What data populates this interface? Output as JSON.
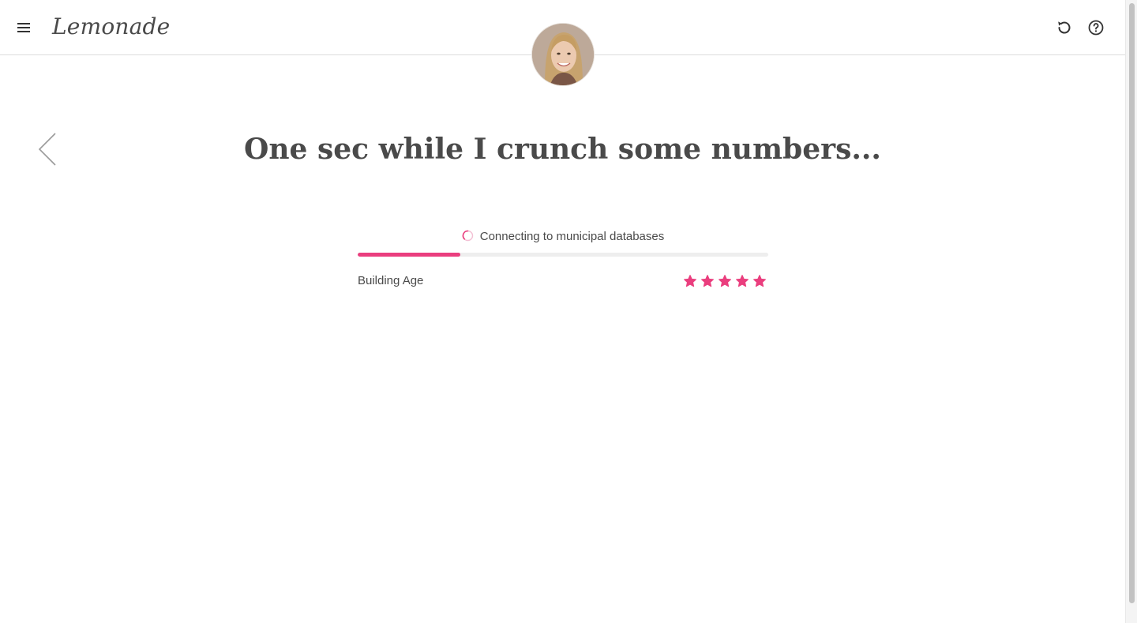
{
  "brand": {
    "logo_text": "Lemonade"
  },
  "header": {
    "menu_icon": "hamburger-menu-icon",
    "restart_icon": "restart-icon",
    "help_icon": "help-question-icon"
  },
  "main": {
    "headline": "One sec while I crunch some numbers...",
    "back_icon": "chevron-left-icon"
  },
  "progress": {
    "status_text": "Connecting to municipal databases",
    "spinner_icon": "loading-spinner-icon",
    "fraction": 0.25
  },
  "rating": {
    "label": "Building Age",
    "stars_filled": 5,
    "stars_total": 5
  },
  "colors": {
    "accent": "#ea3e7e",
    "text": "#4a4a4a",
    "track": "#eeeeee",
    "divider": "#dcdcdc"
  }
}
